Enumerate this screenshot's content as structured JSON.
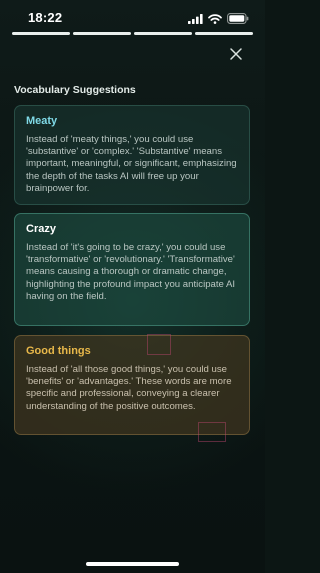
{
  "status_bar": {
    "time": "18:22"
  },
  "icons": {
    "signal": "signal-icon",
    "wifi": "wifi-icon",
    "battery": "battery-icon",
    "close": "close-icon"
  },
  "progress": {
    "total_segments": 4,
    "completed_segments": 4
  },
  "section_title": "Vocabulary Suggestions",
  "cards": [
    {
      "title": "Meaty",
      "title_color": "#7fd9e6",
      "body": "Instead of 'meaty things,' you could use 'substantive' or 'complex.' 'Substantive' means important, meaningful, or significant, emphasizing the depth of the tasks AI will free up your brainpower for."
    },
    {
      "title": "Crazy",
      "title_color": "#ffffff",
      "body": "Instead of 'it's going to be crazy,' you could use 'transformative' or 'revolutionary.' 'Transformative' means causing a thorough or dramatic change, highlighting the profound impact you anticipate AI having on the field."
    },
    {
      "title": "Good things",
      "title_color": "#e8b84a",
      "body": "Instead of 'all those good things,' you could use 'benefits' or 'advantages.' These words are more specific and professional, conveying a clearer understanding of the positive outcomes."
    }
  ]
}
